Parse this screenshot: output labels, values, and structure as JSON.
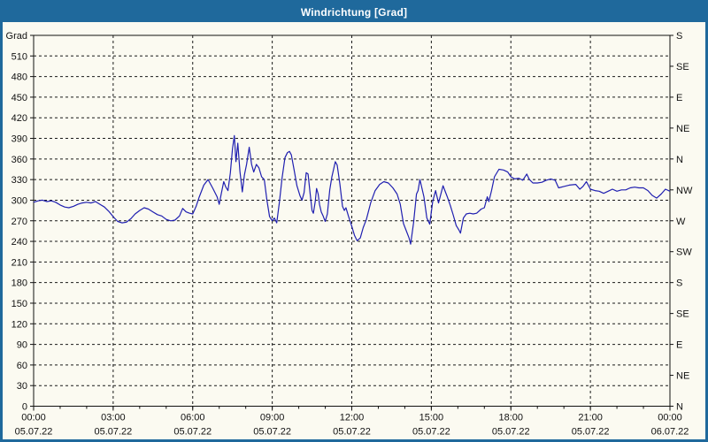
{
  "window": {
    "title": "Windrichtung [Grad]"
  },
  "colors": {
    "frame": "#1f699c",
    "titlebar": "#1f699c",
    "title_text": "#ffffff",
    "background": "#fbfaf1",
    "plot_border": "#111111",
    "grid": "#1a1a1a",
    "axis_text": "#111111",
    "line": "#1f1fb0"
  },
  "chart_data": {
    "type": "line",
    "title": "Windrichtung [Grad]",
    "grid": true,
    "x_axis": {
      "min_hours": 0,
      "max_hours": 24,
      "major_tick_hours": 3,
      "minor_tick_hours": 1,
      "major_labels": [
        {
          "t": 0,
          "time": "00:00",
          "date": "05.07.22"
        },
        {
          "t": 3,
          "time": "03:00",
          "date": "05.07.22"
        },
        {
          "t": 6,
          "time": "06:00",
          "date": "05.07.22"
        },
        {
          "t": 9,
          "time": "09:00",
          "date": "05.07.22"
        },
        {
          "t": 12,
          "time": "12:00",
          "date": "05.07.22"
        },
        {
          "t": 15,
          "time": "15:00",
          "date": "05.07.22"
        },
        {
          "t": 18,
          "time": "18:00",
          "date": "05.07.22"
        },
        {
          "t": 21,
          "time": "21:00",
          "date": "05.07.22"
        },
        {
          "t": 24,
          "time": "00:00",
          "date": "06.07.22"
        }
      ]
    },
    "y_left": {
      "axis_label": "Grad",
      "min": 0,
      "max": 540,
      "tick_step": 30,
      "labeled_ticks": [
        0,
        30,
        60,
        90,
        120,
        150,
        180,
        210,
        240,
        270,
        300,
        330,
        360,
        390,
        420,
        450,
        480,
        510
      ],
      "grid_lines": [
        30,
        60,
        90,
        120,
        150,
        180,
        210,
        240,
        270,
        300,
        330,
        360,
        390,
        420,
        450,
        480,
        510
      ]
    },
    "y_right": {
      "tick_step": 45,
      "labels": [
        {
          "value": 0,
          "label": "N"
        },
        {
          "value": 45,
          "label": "NE"
        },
        {
          "value": 90,
          "label": "E"
        },
        {
          "value": 135,
          "label": "SE"
        },
        {
          "value": 180,
          "label": "S"
        },
        {
          "value": 225,
          "label": "SW"
        },
        {
          "value": 270,
          "label": "W"
        },
        {
          "value": 315,
          "label": "NW"
        },
        {
          "value": 360,
          "label": "N"
        },
        {
          "value": 405,
          "label": "NE"
        },
        {
          "value": 450,
          "label": "E"
        },
        {
          "value": 495,
          "label": "SE"
        },
        {
          "value": 540,
          "label": "S"
        }
      ]
    },
    "series": [
      {
        "name": "Windrichtung",
        "color": "#1f1fb0",
        "points": [
          [
            0,
            297
          ],
          [
            0.17,
            299
          ],
          [
            0.33,
            300
          ],
          [
            0.5,
            298
          ],
          [
            0.67,
            299
          ],
          [
            0.83,
            297
          ],
          [
            1,
            293
          ],
          [
            1.17,
            290
          ],
          [
            1.33,
            289
          ],
          [
            1.5,
            291
          ],
          [
            1.67,
            294
          ],
          [
            1.83,
            296
          ],
          [
            2,
            297
          ],
          [
            2.17,
            296
          ],
          [
            2.33,
            298
          ],
          [
            2.5,
            294
          ],
          [
            2.67,
            290
          ],
          [
            2.83,
            284
          ],
          [
            3,
            276
          ],
          [
            3.17,
            269
          ],
          [
            3.33,
            267
          ],
          [
            3.5,
            268
          ],
          [
            3.67,
            273
          ],
          [
            3.83,
            280
          ],
          [
            4,
            285
          ],
          [
            4.17,
            289
          ],
          [
            4.33,
            287
          ],
          [
            4.5,
            283
          ],
          [
            4.67,
            279
          ],
          [
            4.83,
            277
          ],
          [
            5,
            272
          ],
          [
            5.17,
            270
          ],
          [
            5.33,
            271
          ],
          [
            5.5,
            277
          ],
          [
            5.62,
            288
          ],
          [
            5.75,
            283
          ],
          [
            5.88,
            281
          ],
          [
            6,
            280
          ],
          [
            6.13,
            291
          ],
          [
            6.25,
            305
          ],
          [
            6.42,
            322
          ],
          [
            6.58,
            330
          ],
          [
            6.75,
            318
          ],
          [
            6.92,
            305
          ],
          [
            7,
            294
          ],
          [
            7.08,
            310
          ],
          [
            7.17,
            327
          ],
          [
            7.25,
            319
          ],
          [
            7.33,
            314
          ],
          [
            7.42,
            340
          ],
          [
            7.5,
            375
          ],
          [
            7.57,
            394
          ],
          [
            7.63,
            356
          ],
          [
            7.7,
            383
          ],
          [
            7.78,
            342
          ],
          [
            7.87,
            312
          ],
          [
            7.95,
            337
          ],
          [
            8.03,
            352
          ],
          [
            8.13,
            377
          ],
          [
            8.22,
            352
          ],
          [
            8.3,
            341
          ],
          [
            8.4,
            352
          ],
          [
            8.5,
            347
          ],
          [
            8.6,
            334
          ],
          [
            8.7,
            330
          ],
          [
            8.8,
            300
          ],
          [
            8.9,
            276
          ],
          [
            9,
            270
          ],
          [
            9.08,
            274
          ],
          [
            9.17,
            267
          ],
          [
            9.27,
            297
          ],
          [
            9.37,
            332
          ],
          [
            9.48,
            362
          ],
          [
            9.57,
            369
          ],
          [
            9.65,
            371
          ],
          [
            9.72,
            366
          ],
          [
            9.82,
            345
          ],
          [
            9.93,
            321
          ],
          [
            10.05,
            306
          ],
          [
            10.12,
            300
          ],
          [
            10.2,
            311
          ],
          [
            10.28,
            340
          ],
          [
            10.35,
            338
          ],
          [
            10.43,
            309
          ],
          [
            10.5,
            285
          ],
          [
            10.55,
            281
          ],
          [
            10.62,
            298
          ],
          [
            10.67,
            317
          ],
          [
            10.73,
            309
          ],
          [
            10.78,
            294
          ],
          [
            10.85,
            283
          ],
          [
            10.92,
            277
          ],
          [
            11,
            269
          ],
          [
            11.08,
            280
          ],
          [
            11.17,
            315
          ],
          [
            11.25,
            334
          ],
          [
            11.38,
            356
          ],
          [
            11.45,
            351
          ],
          [
            11.55,
            324
          ],
          [
            11.65,
            291
          ],
          [
            11.72,
            285
          ],
          [
            11.78,
            289
          ],
          [
            11.88,
            276
          ],
          [
            12,
            262
          ],
          [
            12.1,
            249
          ],
          [
            12.2,
            241
          ],
          [
            12.32,
            245
          ],
          [
            12.43,
            260
          ],
          [
            12.55,
            272
          ],
          [
            12.71,
            296
          ],
          [
            12.88,
            314
          ],
          [
            13.05,
            323
          ],
          [
            13.21,
            327
          ],
          [
            13.38,
            325
          ],
          [
            13.55,
            318
          ],
          [
            13.71,
            309
          ],
          [
            13.83,
            294
          ],
          [
            13.95,
            266
          ],
          [
            14.05,
            256
          ],
          [
            14.16,
            245
          ],
          [
            14.22,
            236
          ],
          [
            14.33,
            267
          ],
          [
            14.44,
            309
          ],
          [
            14.5,
            314
          ],
          [
            14.57,
            330
          ],
          [
            14.72,
            305
          ],
          [
            14.83,
            274
          ],
          [
            14.94,
            265
          ],
          [
            15.05,
            298
          ],
          [
            15.16,
            314
          ],
          [
            15.27,
            296
          ],
          [
            15.44,
            321
          ],
          [
            15.6,
            305
          ],
          [
            15.72,
            292
          ],
          [
            15.83,
            278
          ],
          [
            15.94,
            263
          ],
          [
            16.05,
            256
          ],
          [
            16.1,
            252
          ],
          [
            16.21,
            274
          ],
          [
            16.32,
            280
          ],
          [
            16.45,
            281
          ],
          [
            16.58,
            280
          ],
          [
            16.71,
            281
          ],
          [
            16.88,
            287
          ],
          [
            17,
            289
          ],
          [
            17.11,
            305
          ],
          [
            17.17,
            298
          ],
          [
            17.27,
            314
          ],
          [
            17.38,
            334
          ],
          [
            17.55,
            345
          ],
          [
            17.72,
            344
          ],
          [
            17.88,
            341
          ],
          [
            18,
            334
          ],
          [
            18.15,
            331
          ],
          [
            18.3,
            332
          ],
          [
            18.45,
            329
          ],
          [
            18.6,
            338
          ],
          [
            18.7,
            330
          ],
          [
            18.83,
            325
          ],
          [
            19,
            325
          ],
          [
            19.17,
            326
          ],
          [
            19.33,
            329
          ],
          [
            19.5,
            331
          ],
          [
            19.67,
            329
          ],
          [
            19.8,
            318
          ],
          [
            20,
            320
          ],
          [
            20.2,
            322
          ],
          [
            20.45,
            323
          ],
          [
            20.6,
            316
          ],
          [
            20.72,
            320
          ],
          [
            20.85,
            327
          ],
          [
            21,
            316
          ],
          [
            21.17,
            314
          ],
          [
            21.33,
            313
          ],
          [
            21.5,
            310
          ],
          [
            21.67,
            313
          ],
          [
            21.83,
            316
          ],
          [
            22,
            313
          ],
          [
            22.17,
            315
          ],
          [
            22.33,
            315
          ],
          [
            22.5,
            318
          ],
          [
            22.67,
            319
          ],
          [
            22.83,
            318
          ],
          [
            23,
            318
          ],
          [
            23.17,
            314
          ],
          [
            23.33,
            307
          ],
          [
            23.5,
            303
          ],
          [
            23.67,
            309
          ],
          [
            23.83,
            316
          ],
          [
            24,
            313
          ]
        ]
      }
    ]
  }
}
